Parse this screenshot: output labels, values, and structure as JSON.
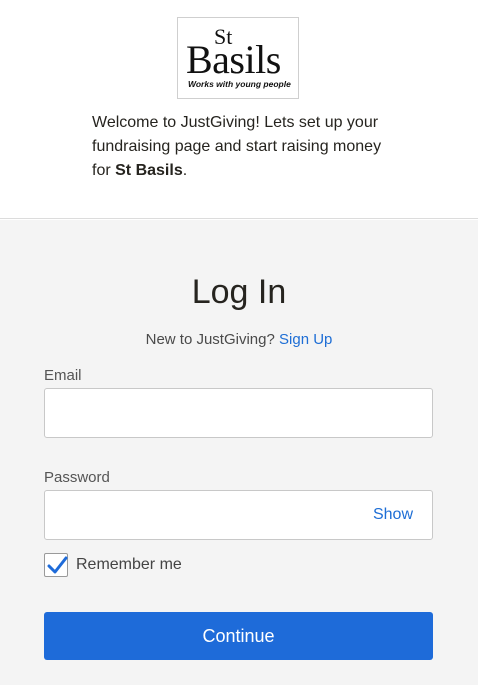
{
  "logo": {
    "line1": "St",
    "line2": "Basils",
    "tagline": "Works with young people"
  },
  "welcome": {
    "text_before": "Welcome to JustGiving! Lets set up your fundraising page and start raising money for ",
    "charity": "St Basils",
    "text_after": "."
  },
  "login": {
    "title": "Log In",
    "new_prompt": "New to JustGiving?",
    "signup_link": "Sign Up",
    "email_label": "Email",
    "email_value": "",
    "password_label": "Password",
    "password_value": "",
    "show_label": "Show",
    "remember_label": "Remember me",
    "remember_checked": true,
    "continue_label": "Continue"
  },
  "colors": {
    "accent": "#1e6bd9",
    "link": "#1e6ed5",
    "logo_dot": "#e02a1e",
    "panel_bg": "#f4f4f4"
  },
  "icons": {
    "checkbox": "checkmark-icon"
  }
}
